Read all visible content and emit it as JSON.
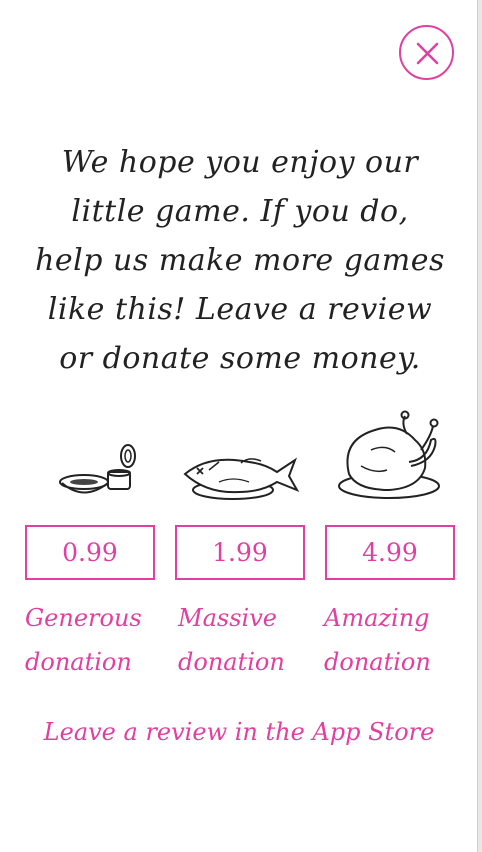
{
  "close_button": {
    "icon": "close-icon"
  },
  "message": {
    "lines": [
      "We hope you enjoy our",
      "little game. If you do,",
      "help us make more games",
      "like this! Leave a review",
      "or donate some money."
    ]
  },
  "donations": [
    {
      "icon": "cat-food-bowl-icon",
      "price": "0.99",
      "label_line1": "Generous",
      "label_line2": "donation"
    },
    {
      "icon": "fish-on-plate-icon",
      "price": "1.99",
      "label_line1": "Massive",
      "label_line2": "donation"
    },
    {
      "icon": "roast-chicken-icon",
      "price": "4.99",
      "label_line1": "Amazing",
      "label_line2": "donation"
    }
  ],
  "review_link": "Leave a review in the App Store",
  "colors": {
    "accent": "#e0409f",
    "text": "#222222",
    "background": "#ffffff"
  }
}
